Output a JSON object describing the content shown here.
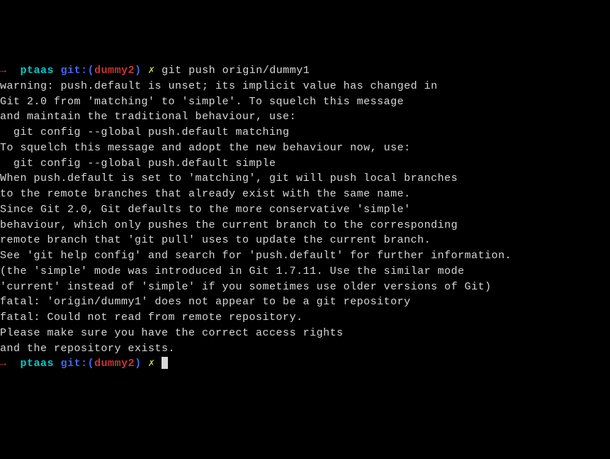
{
  "prompt1": {
    "arrow": "→",
    "dir": "ptaas",
    "git_label": "git:(",
    "branch": "dummy2",
    "git_close": ")",
    "symbol": "✗",
    "command": "git push origin/dummy1"
  },
  "output": [
    "warning: push.default is unset; its implicit value has changed in",
    "Git 2.0 from 'matching' to 'simple'. To squelch this message",
    "and maintain the traditional behaviour, use:",
    "",
    "  git config --global push.default matching",
    "",
    "To squelch this message and adopt the new behaviour now, use:",
    "",
    "  git config --global push.default simple",
    "",
    "When push.default is set to 'matching', git will push local branches",
    "to the remote branches that already exist with the same name.",
    "",
    "Since Git 2.0, Git defaults to the more conservative 'simple'",
    "behaviour, which only pushes the current branch to the corresponding",
    "remote branch that 'git pull' uses to update the current branch.",
    "",
    "See 'git help config' and search for 'push.default' for further information.",
    "(the 'simple' mode was introduced in Git 1.7.11. Use the similar mode",
    "'current' instead of 'simple' if you sometimes use older versions of Git)",
    "",
    "fatal: 'origin/dummy1' does not appear to be a git repository",
    "fatal: Could not read from remote repository.",
    "",
    "Please make sure you have the correct access rights",
    "and the repository exists."
  ],
  "prompt2": {
    "arrow": "→",
    "dir": "ptaas",
    "git_label": "git:(",
    "branch": "dummy2",
    "git_close": ")",
    "symbol": "✗"
  }
}
